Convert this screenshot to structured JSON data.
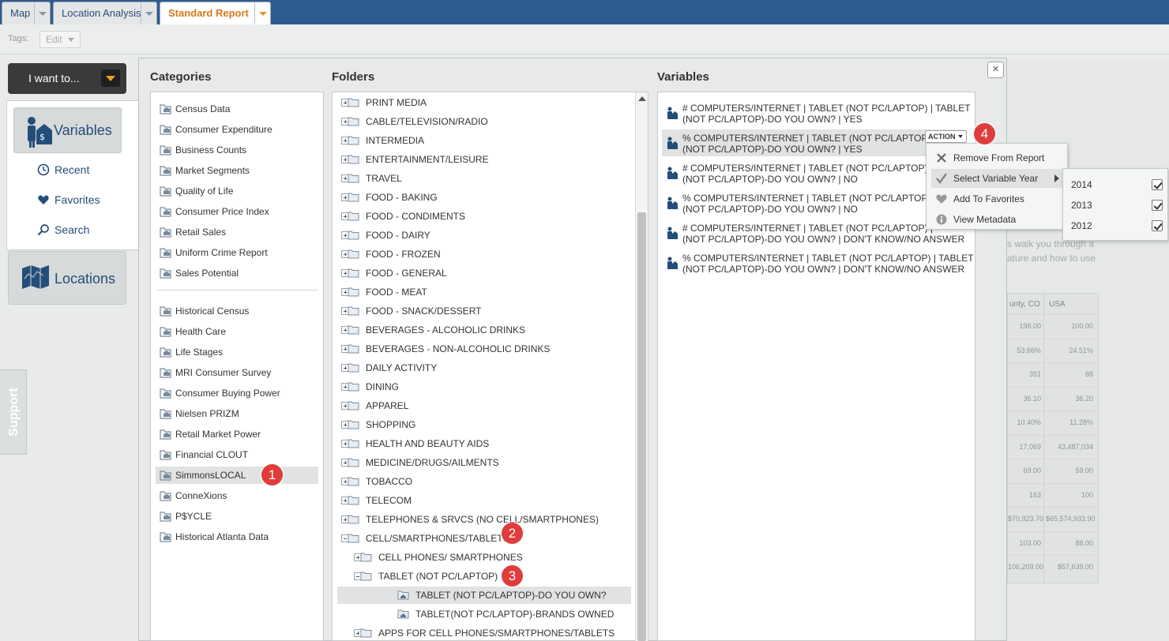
{
  "tabs": [
    {
      "label": "Map"
    },
    {
      "label": "Location Analysis"
    },
    {
      "label": "Standard Report"
    }
  ],
  "tags": {
    "label": "Tags:",
    "edit_label": "Edit"
  },
  "nav": {
    "iwant_label": "I want to...",
    "variables_label": "Variables",
    "recent_label": "Recent",
    "favorites_label": "Favorites",
    "search_label": "Search",
    "locations_label": "Locations",
    "support_label": "Support"
  },
  "dialog": {
    "categories_title": "Categories",
    "folders_title": "Folders",
    "variables_title": "Variables",
    "close_symbol": "×"
  },
  "categories": [
    "Census Data",
    "Consumer Expenditure",
    "Business Counts",
    "Market Segments",
    "Quality of Life",
    "Consumer Price Index",
    "Retail Sales",
    "Uniform Crime Report",
    "Sales Potential",
    "Historical Census",
    "Health Care",
    "Life Stages",
    "MRI Consumer Survey",
    "Consumer Buying Power",
    "Nielsen PRIZM",
    "Retail Market Power",
    "Financial CLOUT",
    "SimmonsLOCAL",
    "ConneXions",
    "P$YCLE",
    "Historical Atlanta Data"
  ],
  "folders": [
    "PRINT MEDIA",
    "CABLE/TELEVISION/RADIO",
    "INTERMEDIA",
    "ENTERTAINMENT/LEISURE",
    "TRAVEL",
    "FOOD - BAKING",
    "FOOD - CONDIMENTS",
    "FOOD - DAIRY",
    "FOOD - FROZEN",
    "FOOD - GENERAL",
    "FOOD - MEAT",
    "FOOD - SNACK/DESSERT",
    "BEVERAGES - ALCOHOLIC DRINKS",
    "BEVERAGES - NON-ALCOHOLIC DRINKS",
    "DAILY ACTIVITY",
    "DINING",
    "APPAREL",
    "SHOPPING",
    "HEALTH AND BEAUTY AIDS",
    "MEDICINE/DRUGS/AILMENTS",
    "TOBACCO",
    "TELECOM",
    "TELEPHONES & SRVCS (NO CELL/SMARTPHONES)",
    "CELL/SMARTPHONES/TABLETS",
    "CELL PHONES/ SMARTPHONES",
    "TABLET (NOT PC/LAPTOP)",
    "TABLET (NOT PC/LAPTOP)-DO YOU OWN?",
    "TABLET(NOT PC/LAPTOP)-BRANDS OWNED",
    "APPS FOR CELL PHONES/SMARTPHONES/TABLETS"
  ],
  "variables": [
    {
      "line1": "# COMPUTERS/INTERNET | TABLET (NOT PC/LAPTOP) | TABLET",
      "line2": "(NOT PC/LAPTOP)-DO YOU OWN? | YES"
    },
    {
      "line1": "% COMPUTERS/INTERNET | TABLET (NOT PC/LAPTOP) |",
      "line2": "(NOT PC/LAPTOP)-DO YOU OWN? | YES"
    },
    {
      "line1": "# COMPUTERS/INTERNET | TABLET (NOT PC/LAPTOP) |",
      "line2": "(NOT PC/LAPTOP)-DO YOU OWN? | NO"
    },
    {
      "line1": "% COMPUTERS/INTERNET | TABLET (NOT PC/LAPTOP) |",
      "line2": "(NOT PC/LAPTOP)-DO YOU OWN? | NO"
    },
    {
      "line1": "# COMPUTERS/INTERNET | TABLET (NOT PC/LAPTOP) |",
      "line2": "(NOT PC/LAPTOP)-DO YOU OWN? | DON'T KNOW/NO ANSWER"
    },
    {
      "line1": "% COMPUTERS/INTERNET | TABLET (NOT PC/LAPTOP) | TABLET",
      "line2": "(NOT PC/LAPTOP)-DO YOU OWN? | DON'T KNOW/NO ANSWER"
    }
  ],
  "action": {
    "button_label": "ACTION",
    "menu": [
      "Remove From Report",
      "Select Variable Year",
      "Add To Favorites",
      "View Metadata"
    ],
    "years": [
      "2014",
      "2013",
      "2012"
    ]
  },
  "badges": [
    "1",
    "2",
    "3",
    "4"
  ],
  "background_report": {
    "text_line1": "s walk you through a",
    "text_line2": "ature and how to use",
    "col1_header": "unty, CO",
    "col2_header": "USA",
    "col1_values": [
      "198.00",
      "53.66%",
      "351",
      "36.10",
      "10.40%",
      "17,069",
      "69.00",
      "163",
      "$70,923.70",
      "103.00",
      "106,209.00"
    ],
    "col2_values": [
      "100.00",
      "24.51%",
      "88",
      "36.20",
      "11.28%",
      "43,487,034",
      "59.00",
      "100",
      "$65,574,933.90",
      "88.00",
      "$57,639.00"
    ]
  },
  "colors": {
    "accent_orange": "#d67a1a",
    "nav_blue": "#234e7a",
    "topbar": "#2f5c8f",
    "badge_red": "#e03c3c"
  }
}
